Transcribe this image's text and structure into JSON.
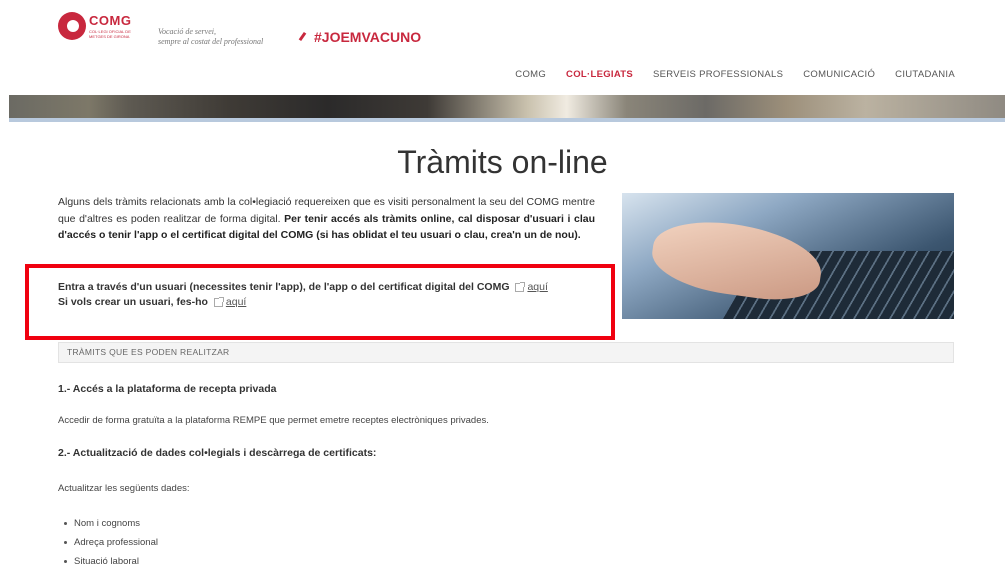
{
  "header": {
    "logo_text": "COMG",
    "logo_sub": "COL·LEGI OFICIAL DE METGES DE GIRONA",
    "tagline_line1": "Vocació de servei,",
    "tagline_line2": "sempre al costat del professional",
    "hashtag": "#JOEMVACUNO"
  },
  "nav": {
    "items": [
      "COMG",
      "COL·LEGIATS",
      "SERVEIS PROFESSIONALS",
      "COMUNICACIÓ",
      "CIUTADANIA"
    ],
    "active": "COL·LEGIATS"
  },
  "page_title": "Tràmits on-line",
  "intro": {
    "text": "Alguns dels tràmits relacionats amb la col•legiació requereixen que es visiti personalment la seu del COMG mentre que d'altres es poden realitzar de forma digital. ",
    "bold": "Per tenir accés als tràmits online, cal disposar d'usuari i clau d'accés o tenir l'app o el certificat digital del COMG (si has oblidat el teu usuari o clau, crea'n un de nou)."
  },
  "access": {
    "line1": "Entra a través d'un usuari (necessites tenir l'app), de l'app o del certificat digital del COMG",
    "link1": "aquí",
    "line2": "Si vols crear un usuari, fes-ho",
    "link2": "aquí"
  },
  "section_bar": "TRÀMITS QUE ES PODEN REALITZAR",
  "items": {
    "h1": "1.- Accés a la plataforma de recepta privada",
    "p1": "Accedir de forma gratuïta a la plataforma REMPE que permet emetre receptes electròniques privades.",
    "h2": "2.- Actualització de dades col•legials i descàrrega de certificats:",
    "p2": "Actualitzar les següents dades:",
    "list": [
      "Nom i cognoms",
      "Adreça professional",
      "Situació laboral"
    ]
  },
  "colors": {
    "brand": "#c8283e",
    "highlight": "#f0000f"
  }
}
